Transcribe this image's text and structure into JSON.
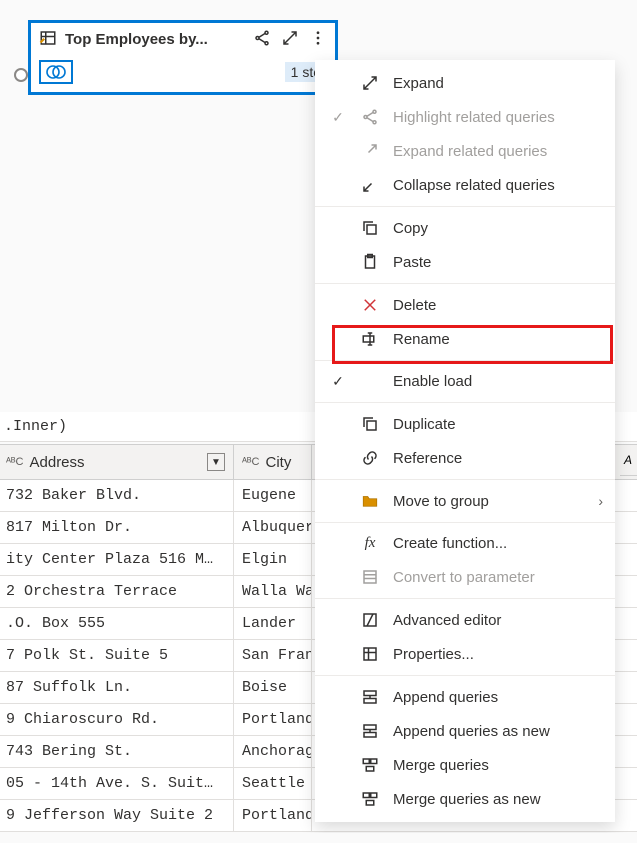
{
  "query": {
    "title": "Top Employees by...",
    "steps_badge": "1 ste"
  },
  "menu": {
    "expand": "Expand",
    "highlight_related": "Highlight related queries",
    "expand_related": "Expand related queries",
    "collapse_related": "Collapse related queries",
    "copy": "Copy",
    "paste": "Paste",
    "delete": "Delete",
    "rename": "Rename",
    "enable_load": "Enable load",
    "duplicate": "Duplicate",
    "reference": "Reference",
    "move_to_group": "Move to group",
    "create_function": "Create function...",
    "convert_to_parameter": "Convert to parameter",
    "advanced_editor": "Advanced editor",
    "properties": "Properties...",
    "append_queries": "Append queries",
    "append_queries_new": "Append queries as new",
    "merge_queries": "Merge queries",
    "merge_queries_new": "Merge queries as new"
  },
  "formula": ".Inner)",
  "columns": {
    "c1": "Address",
    "c2": "City",
    "type_prefix": "ᴬᴮC"
  },
  "rows": [
    {
      "addr": "732 Baker Blvd.",
      "city": "Eugene"
    },
    {
      "addr": "817 Milton Dr.",
      "city": "Albuquer"
    },
    {
      "addr": "ity Center Plaza 516 M…",
      "city": "Elgin"
    },
    {
      "addr": "2 Orchestra Terrace",
      "city": "Walla Wa"
    },
    {
      "addr": ".O. Box 555",
      "city": "Lander"
    },
    {
      "addr": "7 Polk St. Suite 5",
      "city": "San Fran"
    },
    {
      "addr": "87 Suffolk Ln.",
      "city": "Boise"
    },
    {
      "addr": "9 Chiaroscuro Rd.",
      "city": "Portland"
    },
    {
      "addr": "743 Bering St.",
      "city": "Anchorag"
    },
    {
      "addr": "05 - 14th Ave. S. Suit…",
      "city": "Seattle"
    },
    {
      "addr": "9 Jefferson Way Suite 2",
      "city": "Portland"
    }
  ],
  "right_stub": "A"
}
